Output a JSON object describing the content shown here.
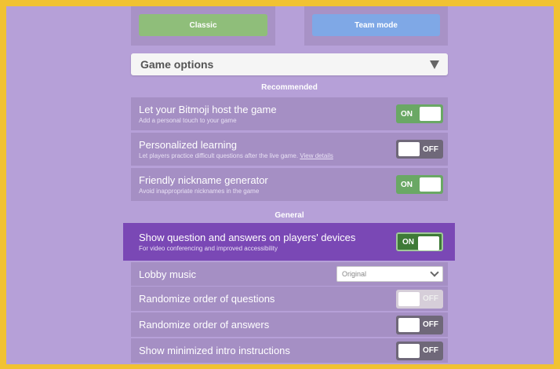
{
  "modes": {
    "classic_label": "Classic",
    "team_label": "Team mode"
  },
  "game_options": {
    "label": "Game options"
  },
  "sections": {
    "recommended": "Recommended",
    "general": "General"
  },
  "options": {
    "bitmoji": {
      "title": "Let your Bitmoji host the game",
      "subtitle": "Add a personal touch to your game",
      "state": "ON"
    },
    "personalized": {
      "title": "Personalized learning",
      "subtitle": "Let players practice difficult questions after the live game.",
      "link": "View details",
      "state": "OFF"
    },
    "nickname": {
      "title": "Friendly nickname generator",
      "subtitle": "Avoid inappropriate nicknames in the game",
      "state": "ON"
    },
    "show_questions": {
      "title": "Show question and answers on players' devices",
      "subtitle": "For video conferencing and improved accessibility",
      "state": "ON"
    },
    "lobby_music": {
      "title": "Lobby music",
      "value": "Original"
    },
    "randomize_questions": {
      "title": "Randomize order of questions",
      "state": "OFF"
    },
    "randomize_answers": {
      "title": "Randomize order of answers",
      "state": "OFF"
    },
    "minimized_intro": {
      "title": "Show minimized intro instructions",
      "state": "OFF"
    }
  },
  "colors": {
    "background_border": "#f1c232",
    "panel": "#b6a0d8",
    "classic_button": "#8fbe7a",
    "team_button": "#7fa8e6",
    "toggle_on": "#6aa865",
    "highlight": "#7a48b5"
  }
}
